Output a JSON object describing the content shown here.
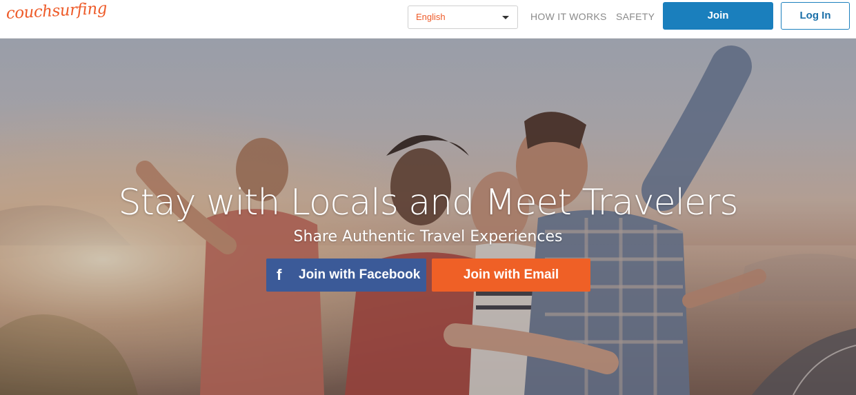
{
  "header": {
    "logo_text": "couchsurfing",
    "language": {
      "selected": "English"
    },
    "nav": {
      "how_it_works": "HOW IT WORKS",
      "safety": "SAFETY"
    },
    "join_label": "Join",
    "login_label": "Log In"
  },
  "hero": {
    "title": "Stay with Locals and Meet Travelers",
    "subtitle": "Share Authentic Travel Experiences",
    "facebook_button": {
      "icon": "facebook-icon",
      "icon_glyph": "f",
      "label": "Join with Facebook"
    },
    "email_button": {
      "label": "Join with Email"
    }
  },
  "colors": {
    "brand_orange": "#ee5b29",
    "join_blue": "#1a7fbd",
    "facebook_blue": "#3b5a98",
    "email_orange": "#ef6026"
  }
}
